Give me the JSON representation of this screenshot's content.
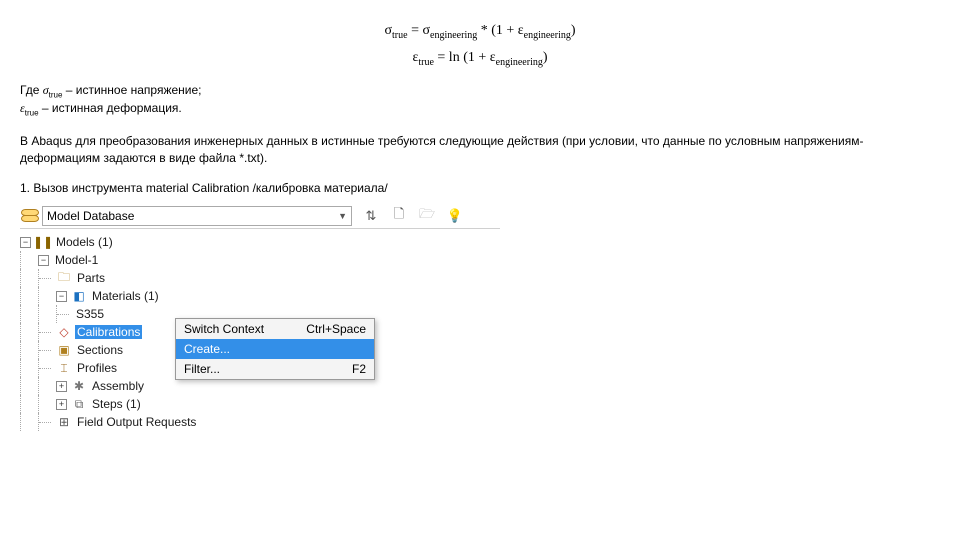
{
  "formulas": {
    "line1": "σₜᵣᵤₑ = σₑₙgᵢₙₑₑᵣᵢₙg * (1 + εₑₙgᵢₙₑₑᵣᵢₙg)",
    "line2": "εₜᵣᵤₑ = ln (1 + εₑₙgᵢₙₑₑᵣᵢₙg)"
  },
  "definitions": {
    "text_prefix": "Где ",
    "sigma_symbol": "σ",
    "sigma_sub": "true",
    "sigma_desc": " – истинное напряжение;",
    "eps_symbol": "ε",
    "eps_sub": "true",
    "eps_desc": " – истинная деформация."
  },
  "paragraph1": "В Abaqus для преобразования инженерных данных в истинные требуются следующие действия (при условии, что данные по условным напряжениям-деформациям задаются в виде файла *.txt).",
  "paragraph2": "1. Вызов инструмента material Calibration /калибровка материала/",
  "toolbar": {
    "db_label": "Model Database"
  },
  "tree": {
    "models": "Models (1)",
    "model1": "Model-1",
    "parts": "Parts",
    "materials": "Materials (1)",
    "s355": "S355",
    "calibrations": "Calibrations",
    "sections": "Sections",
    "profiles": "Profiles",
    "assembly": "Assembly",
    "steps": "Steps (1)",
    "field": "Field Output Requests"
  },
  "context_menu": {
    "switch": "Switch Context",
    "switch_shortcut": "Ctrl+Space",
    "create": "Create...",
    "filter": "Filter...",
    "filter_shortcut": "F2"
  }
}
